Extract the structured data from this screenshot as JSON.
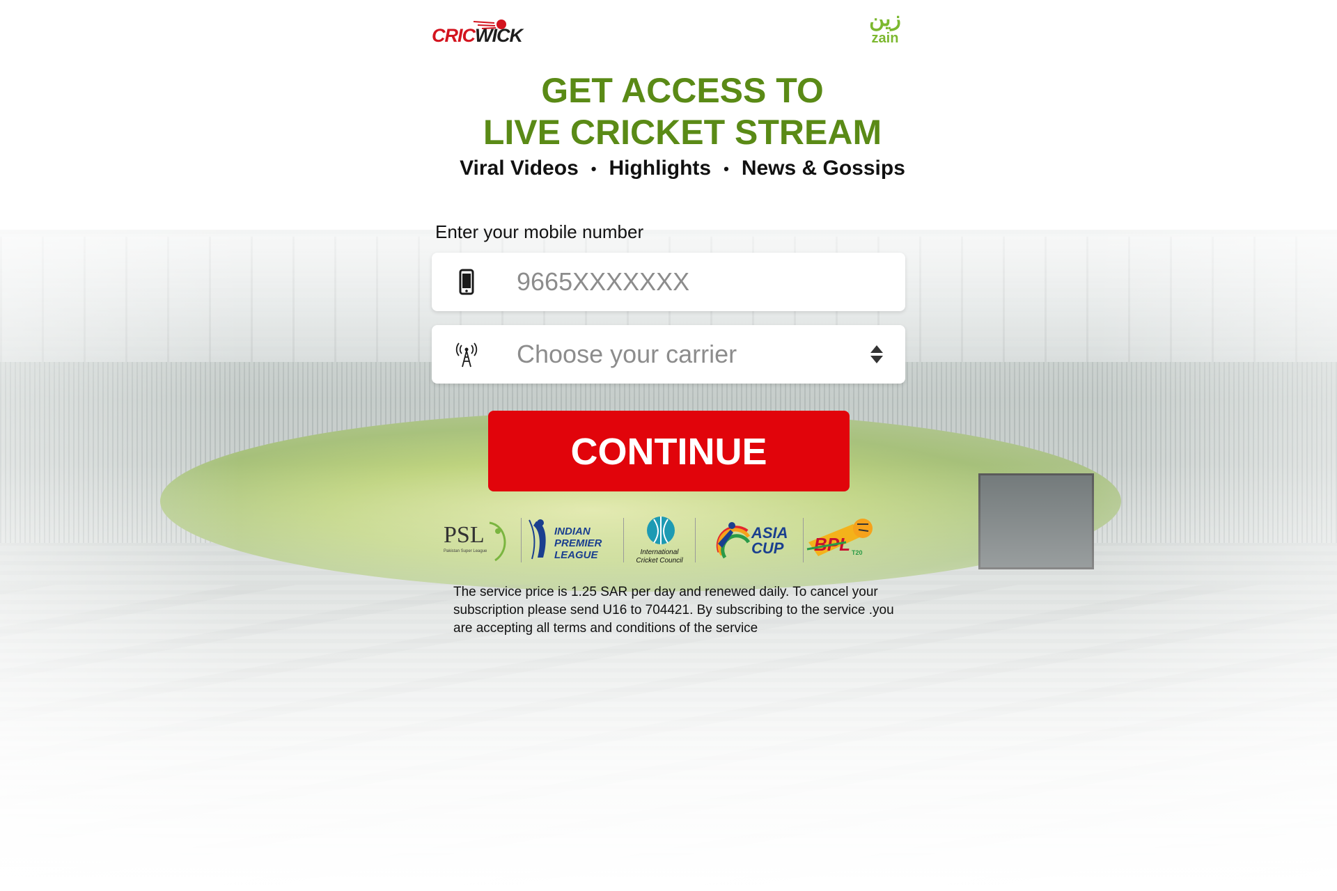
{
  "brand": {
    "cricwick_part1": "CRIC",
    "cricwick_part2": "WICK",
    "operator_glyph": "زين",
    "operator_name": "zain"
  },
  "headline": {
    "line1": "GET ACCESS TO",
    "line2": "LIVE CRICKET STREAM"
  },
  "features": [
    "Viral Videos",
    "Highlights",
    "News & Gossips"
  ],
  "feature_separator": "•",
  "form": {
    "mobile_label": "Enter your mobile number",
    "mobile_placeholder": "9665XXXXXXX",
    "carrier_placeholder": "Choose your carrier",
    "continue_label": "CONTINUE"
  },
  "leagues": {
    "psl": {
      "abbr": "PSL",
      "name": "Pakistan Super League"
    },
    "ipl": {
      "line1": "INDIAN",
      "line2": "PREMIER",
      "line3": "LEAGUE"
    },
    "icc": {
      "line1": "International",
      "line2": "Cricket Council"
    },
    "asia": {
      "line1": "ASIA",
      "line2": "CUP"
    },
    "bpl": {
      "abbr": "BPL",
      "sub": "T20"
    }
  },
  "disclaimer": "The service price is 1.25 SAR per day and renewed daily. To cancel your subscription please send U16 to 704421. By subscribing to the service .you are accepting all terms and conditions of the service",
  "colors": {
    "headline_green": "#5a8a16",
    "continue_red": "#e1040b",
    "zain_green": "#7cb82f",
    "cricwick_red": "#d3141f"
  }
}
